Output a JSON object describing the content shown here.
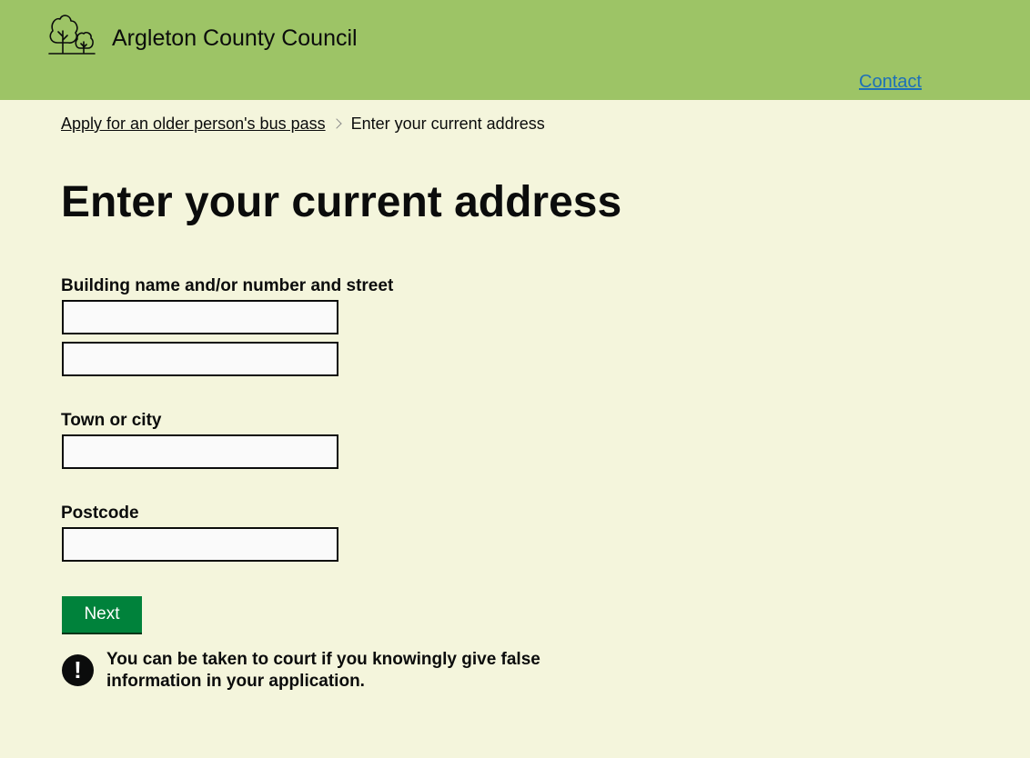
{
  "header": {
    "site_title": "Argleton County Council",
    "contact_link": "Contact",
    "logo_icon": "trees-icon"
  },
  "breadcrumb": {
    "parent": "Apply for an older person's bus pass",
    "current": "Enter your current address"
  },
  "page": {
    "title": "Enter your current address"
  },
  "form": {
    "address_label": "Building name and/or number and street",
    "address_line1_value": "",
    "address_line2_value": "",
    "town_label": "Town or city",
    "town_value": "",
    "postcode_label": "Postcode",
    "postcode_value": "",
    "next_button": "Next"
  },
  "warning": {
    "icon": "!",
    "text": "You can be taken to court if you knowingly give false information in your application."
  },
  "colors": {
    "header_bg": "#9dc466",
    "page_bg": "#f4f5dc",
    "button_bg": "#00823b",
    "link": "#1d70b8"
  }
}
